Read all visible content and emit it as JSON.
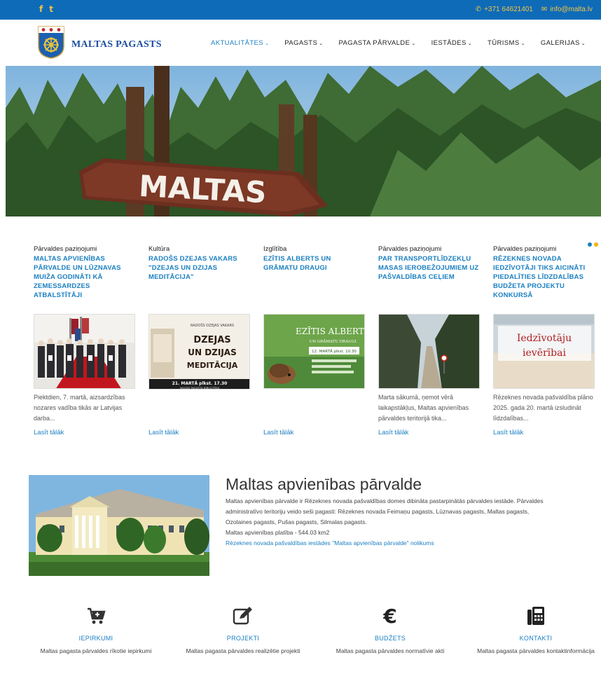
{
  "topbar": {
    "social": [
      "f",
      "t"
    ],
    "phone": "+371 64621401",
    "email": "info@malta.lv"
  },
  "header": {
    "brand": "MALTAS PAGASTS",
    "nav": [
      {
        "label": "AKTUALITĀTES"
      },
      {
        "label": "PAGASTS"
      },
      {
        "label": "PAGASTA PĀRVALDE"
      },
      {
        "label": "IESTĀDES"
      },
      {
        "label": "TŪRISMS"
      },
      {
        "label": "GALERIJAS"
      }
    ]
  },
  "hero": {
    "sign_text": "MALTAS"
  },
  "news": [
    {
      "category": "Pārvaldes paziņojumi",
      "title": "MALTAS APVIENĪBAS PĀRVALDE UN LŪZNAVAS MUIŽA GODINĀTI KĀ ZEMESSARDZES ATBALSTĪTĀJI",
      "excerpt": "Piektdien, 7. martā, aizsardzības nozares vadība tikās ar Latvijas darba...",
      "more": "Lasīt tālāk"
    },
    {
      "category": "Kultūra",
      "title": "RADOŠS DZEJAS VAKARS \"DZEJAS UN DZIJAS MEDITĀCIJA\"",
      "excerpt": "",
      "more": "Lasīt tālāk",
      "thumb_small": "RADOŠS DZEJAS VAKARS",
      "thumb_big": [
        "DZEJAS",
        "UN DZIJAS",
        "MEDITĀCIJA"
      ],
      "thumb_foot": "21. MARTĀ plkst. 17.30",
      "thumb_foot2": "MALTAS PAGASTA BIBLIOTĒKA"
    },
    {
      "category": "Izglītība",
      "title": "EZĪTIS ALBERTS UN GRĀMATU DRAUGI",
      "excerpt": "",
      "more": "Lasīt tālāk",
      "thumb_title": "EZĪTIS ALBERTS",
      "thumb_sub": "UN GRĀMATU DRAUGI",
      "thumb_date": "12. MARTĀ plkst. 10.30"
    },
    {
      "category": "Pārvaldes paziņojumi",
      "title": "PAR TRANSPORTLĪDZEKĻU MASAS IEROBEŽOJUMIEM UZ PAŠVALDĪBAS CEĻIEM",
      "excerpt": "Marta sākumā, ņemot vērā laikapstākļus, Maltas apvienības pārvaldes teritorijā tika...",
      "more": "Lasīt tālāk"
    },
    {
      "category": "Pārvaldes paziņojumi",
      "title": "RĒZEKNES NOVADA IEDZĪVOTĀJI TIKS AICINĀTI PIEDALĪTIES LĪDZDALĪBAS BUDŽETA PROJEKTU KONKURSĀ",
      "excerpt": "Rēzeknes novada pašvaldība plāno 2025. gada 20. martā izsludināt līdzdalības...",
      "more": "Lasīt tālāk",
      "thumb_text": [
        "Iedzīvotāju",
        "ievērībai"
      ]
    }
  ],
  "about": {
    "title": "Maltas apvienības pārvalde",
    "lines": [
      "Maltas apvienības pārvalde ir Rēzeknes novada pašvaldības domes dibināta pastarpinātās pārvaldes iestāde. Pārvaldes",
      "administratīvo teritoriju veido seši pagasti: Rēzeknes novada Feimaņu pagasts, Lūznavas pagasts, Maltas pagasts,",
      "Ozolaines pagasts, Pušas pagasts, Silmalas pagasts.",
      "Maltas apvienības platība - 544.03 km2"
    ],
    "link": "Rēzeknes novada pašvaldības iestādes \"Maltas apvienības pārvalde\" nolikums"
  },
  "features": [
    {
      "icon": "cart-icon",
      "title": "IEPIRKUMI",
      "desc": "Maltas pagasta pārvaldes rīkotie iepirkumi"
    },
    {
      "icon": "edit-icon",
      "title": "PROJEKTI",
      "desc": "Maltas pagasta pārvaldes realizētie projekti"
    },
    {
      "icon": "euro-icon",
      "title": "BUDŽETS",
      "desc": "Maltas pagasta pārvaldes normatīvie akti"
    },
    {
      "icon": "fax-icon",
      "title": "KONTAKTI",
      "desc": "Maltas pagasta pārvaldes kontaktinformācija"
    }
  ],
  "colors": {
    "topbar": "#0e6bb8",
    "accent": "#1a7fc1",
    "social": "#f4c542",
    "brand": "#1d4fa0"
  }
}
